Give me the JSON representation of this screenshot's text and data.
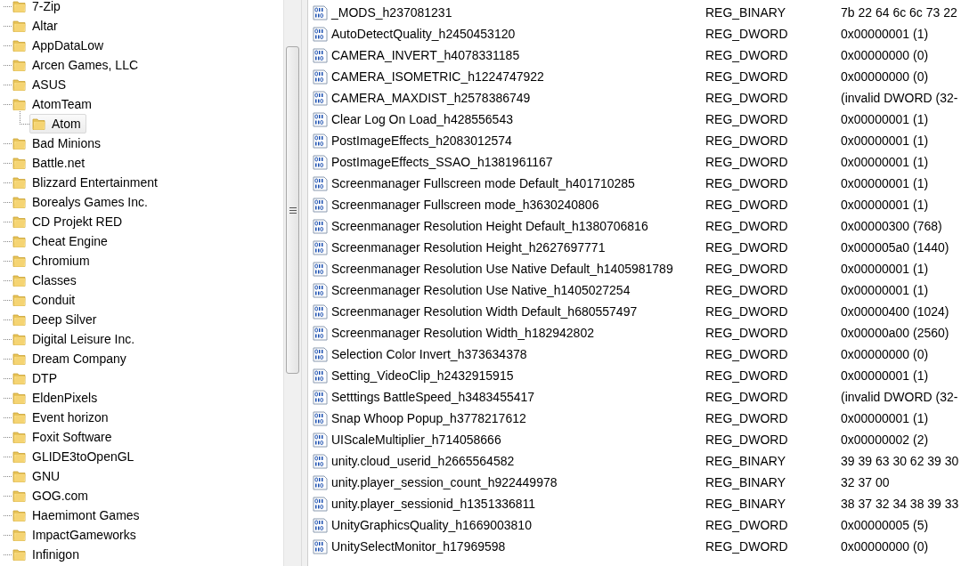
{
  "tree": {
    "items": [
      {
        "label": "7-Zip",
        "selected": false
      },
      {
        "label": "Altar",
        "selected": false
      },
      {
        "label": "AppDataLow",
        "selected": false
      },
      {
        "label": "Arcen Games, LLC",
        "selected": false
      },
      {
        "label": "ASUS",
        "selected": false
      },
      {
        "label": "AtomTeam",
        "selected": false,
        "children": [
          {
            "label": "Atom",
            "selected": true
          }
        ]
      },
      {
        "label": "Bad Minions",
        "selected": false
      },
      {
        "label": "Battle.net",
        "selected": false
      },
      {
        "label": "Blizzard Entertainment",
        "selected": false
      },
      {
        "label": "Borealys Games Inc.",
        "selected": false
      },
      {
        "label": "CD Projekt RED",
        "selected": false
      },
      {
        "label": "Cheat Engine",
        "selected": false
      },
      {
        "label": "Chromium",
        "selected": false
      },
      {
        "label": "Classes",
        "selected": false
      },
      {
        "label": "Conduit",
        "selected": false
      },
      {
        "label": "Deep Silver",
        "selected": false
      },
      {
        "label": "Digital Leisure Inc.",
        "selected": false
      },
      {
        "label": "Dream Company",
        "selected": false
      },
      {
        "label": "DTP",
        "selected": false
      },
      {
        "label": "EldenPixels",
        "selected": false
      },
      {
        "label": "Event horizon",
        "selected": false
      },
      {
        "label": "Foxit Software",
        "selected": false
      },
      {
        "label": "GLIDE3toOpenGL",
        "selected": false
      },
      {
        "label": "GNU",
        "selected": false
      },
      {
        "label": "GOG.com",
        "selected": false
      },
      {
        "label": "Haemimont Games",
        "selected": false
      },
      {
        "label": "ImpactGameworks",
        "selected": false
      },
      {
        "label": "Infinigon",
        "selected": false
      }
    ]
  },
  "values": {
    "rows": [
      {
        "name": "_MODS_h237081231",
        "type": "REG_BINARY",
        "data": "7b 22 64 6c 6c 73 22"
      },
      {
        "name": "AutoDetectQuality_h2450453120",
        "type": "REG_DWORD",
        "data": "0x00000001 (1)"
      },
      {
        "name": "CAMERA_INVERT_h4078331185",
        "type": "REG_DWORD",
        "data": "0x00000000 (0)"
      },
      {
        "name": "CAMERA_ISOMETRIC_h1224747922",
        "type": "REG_DWORD",
        "data": "0x00000000 (0)"
      },
      {
        "name": "CAMERA_MAXDIST_h2578386749",
        "type": "REG_DWORD",
        "data": "(invalid DWORD (32-"
      },
      {
        "name": "Clear Log On Load_h428556543",
        "type": "REG_DWORD",
        "data": "0x00000001 (1)"
      },
      {
        "name": "PostImageEffects_h2083012574",
        "type": "REG_DWORD",
        "data": "0x00000001 (1)"
      },
      {
        "name": "PostImageEffects_SSAO_h1381961167",
        "type": "REG_DWORD",
        "data": "0x00000001 (1)"
      },
      {
        "name": "Screenmanager Fullscreen mode Default_h401710285",
        "type": "REG_DWORD",
        "data": "0x00000001 (1)"
      },
      {
        "name": "Screenmanager Fullscreen mode_h3630240806",
        "type": "REG_DWORD",
        "data": "0x00000001 (1)"
      },
      {
        "name": "Screenmanager Resolution Height Default_h1380706816",
        "type": "REG_DWORD",
        "data": "0x00000300 (768)"
      },
      {
        "name": "Screenmanager Resolution Height_h2627697771",
        "type": "REG_DWORD",
        "data": "0x000005a0 (1440)"
      },
      {
        "name": "Screenmanager Resolution Use Native Default_h1405981789",
        "type": "REG_DWORD",
        "data": "0x00000001 (1)"
      },
      {
        "name": "Screenmanager Resolution Use Native_h1405027254",
        "type": "REG_DWORD",
        "data": "0x00000001 (1)"
      },
      {
        "name": "Screenmanager Resolution Width Default_h680557497",
        "type": "REG_DWORD",
        "data": "0x00000400 (1024)"
      },
      {
        "name": "Screenmanager Resolution Width_h182942802",
        "type": "REG_DWORD",
        "data": "0x00000a00 (2560)"
      },
      {
        "name": "Selection Color Invert_h373634378",
        "type": "REG_DWORD",
        "data": "0x00000000 (0)"
      },
      {
        "name": "Setting_VideoClip_h2432915915",
        "type": "REG_DWORD",
        "data": "0x00000001 (1)"
      },
      {
        "name": "Setttings BattleSpeed_h3483455417",
        "type": "REG_DWORD",
        "data": "(invalid DWORD (32-"
      },
      {
        "name": "Snap Whoop Popup_h3778217612",
        "type": "REG_DWORD",
        "data": "0x00000001 (1)"
      },
      {
        "name": "UIScaleMultiplier_h714058666",
        "type": "REG_DWORD",
        "data": "0x00000002 (2)"
      },
      {
        "name": "unity.cloud_userid_h2665564582",
        "type": "REG_BINARY",
        "data": "39 39 63 30 62 39 30"
      },
      {
        "name": "unity.player_session_count_h922449978",
        "type": "REG_BINARY",
        "data": "32 37 00"
      },
      {
        "name": "unity.player_sessionid_h1351336811",
        "type": "REG_BINARY",
        "data": "38 37 32 34 38 39 33"
      },
      {
        "name": "UnityGraphicsQuality_h1669003810",
        "type": "REG_DWORD",
        "data": "0x00000005 (5)"
      },
      {
        "name": "UnitySelectMonitor_h17969598",
        "type": "REG_DWORD",
        "data": "0x00000000 (0)"
      }
    ]
  }
}
